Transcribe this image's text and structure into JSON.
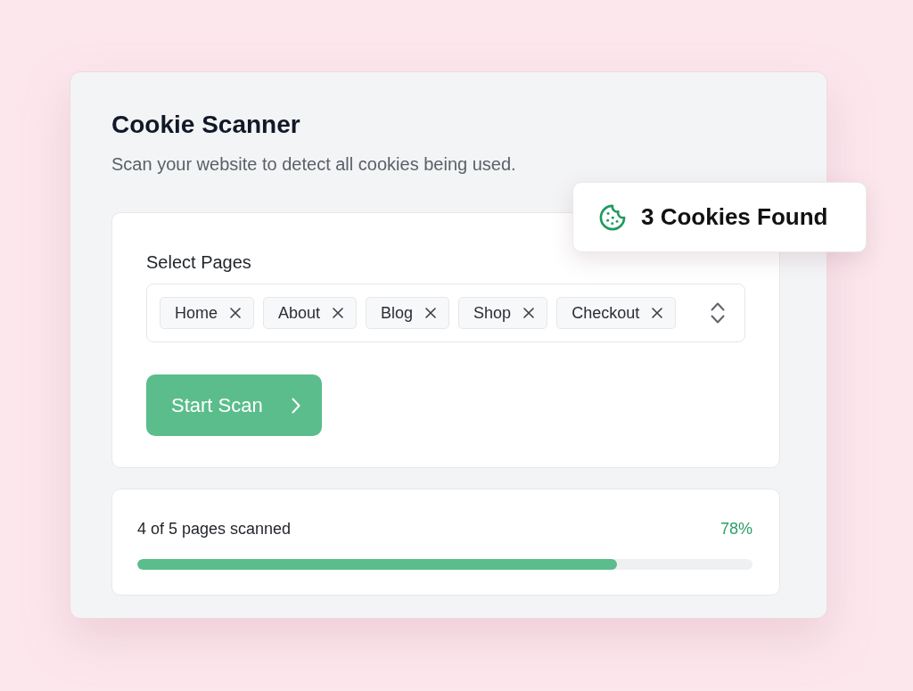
{
  "panel": {
    "title": "Cookie Scanner",
    "subtitle": "Scan your website to detect all cookies being used."
  },
  "badge": {
    "text": "3 Cookies Found"
  },
  "page_selector": {
    "label": "Select Pages",
    "tags": [
      {
        "label": "Home"
      },
      {
        "label": "About"
      },
      {
        "label": "Blog"
      },
      {
        "label": "Shop"
      },
      {
        "label": "Checkout"
      }
    ]
  },
  "scan_button": {
    "label": "Start Scan"
  },
  "progress": {
    "text": "4 of 5 pages scanned",
    "percent": "78%",
    "level": 0.78
  }
}
